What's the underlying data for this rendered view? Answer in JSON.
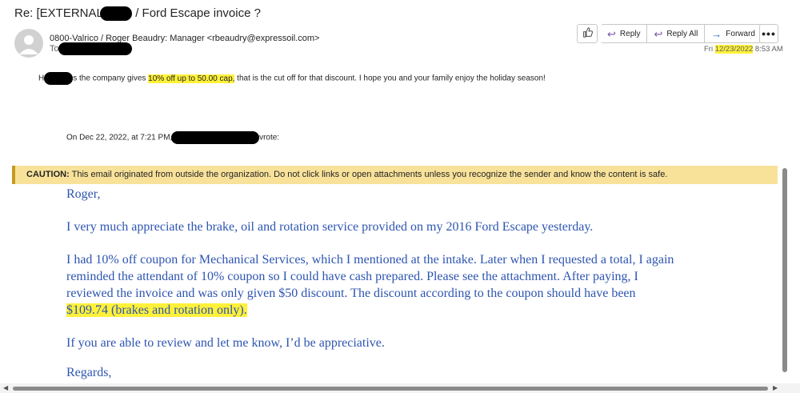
{
  "subject": {
    "prefix": "Re: [EXTERNAL]",
    "rest": " / Ford Escape invoice ?"
  },
  "sender": {
    "from": "0800-Valrico / Roger Beaudry: Manager <rbeaudry@expressoil.com>",
    "to_label": "To"
  },
  "actions": {
    "reply": "Reply",
    "reply_all": "Reply All",
    "forward": "Forward"
  },
  "date": {
    "day": "Fri",
    "date": "12/23/2022",
    "time": "8:53 AM"
  },
  "reply_body": {
    "lead": "H",
    "text_before": "s the company gives ",
    "highlight": "10% off up to 50.00 cap,",
    "text_after": " that is the cut off for that discount. I hope you and your family enjoy the holiday season!"
  },
  "quote_header": {
    "before": "On Dec 22, 2022, at 7:21 PM, ",
    "after": "vrote:"
  },
  "caution": {
    "label": "CAUTION:",
    "text": " This email originated from outside the organization. Do not click links or open attachments unless you recognize the sender and know the content is safe."
  },
  "original": {
    "greeting": "Roger,",
    "p1": "I very much appreciate the brake, oil and rotation service provided on my 2016 Ford Escape yesterday.",
    "p2_l1": "I had 10% off coupon for Mechanical Services, which I mentioned at the intake.  Later when I requested a total, I again",
    "p2_l2": "reminded the attendant of 10% coupon so I could have cash prepared.  Please see the attachment.  After paying, I",
    "p2_l3": "reviewed the invoice and was only given $50 discount.  The discount according to the coupon should have been",
    "p2_l4": "$109.74 (brakes and rotation only).",
    "p3": "If you are able to review and let me know, I’d be appreciative.",
    "closing": "Regards,"
  },
  "colors": {
    "highlight": "#fff13a",
    "caution_bg": "#f8e29a",
    "quote_text": "#2d55b0"
  }
}
